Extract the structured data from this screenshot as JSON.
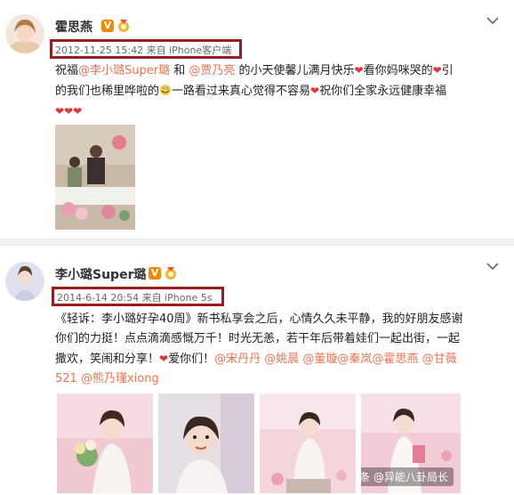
{
  "post1": {
    "username": "霍思燕",
    "timestamp": "2012-11-25 15:42 来自 iPhone客户端",
    "text": {
      "t1": "祝福",
      "m1": "@李小璐Super璐",
      "t2": " 和 ",
      "m2": "@贾乃亮",
      "t3": " 的小天使馨儿满月快乐",
      "t4": "看你妈咪哭的",
      "t5": "引",
      "t6": "的我们也稀里哗啦的",
      "t7": "一路看过来真心觉得不容易",
      "t8": "祝你们全家永远健康幸福",
      "hearts": "❤❤❤"
    }
  },
  "post2": {
    "username": "李小璐Super璐",
    "timestamp": "2014-6-14 20:54 来自 iPhone 5s",
    "text": {
      "l1": "《轻诉：李小璐好孕40周》新书私享会之后，心情久久未平静，我的好朋友感谢",
      "l2": "你们的力挺！点点滴滴感慨万千！时光无恙，若干年后带着娃们一起出街，一起",
      "l3a": "撒欢，笑闹和分享！",
      "l3b": "爱你们！",
      "m1": "@宋丹丹",
      "m2": "@姚晨",
      "m3": "@董璇",
      "m4": "@秦岚",
      "m5": "@霍思燕",
      "m6": "@甘薇",
      "l4a": "521",
      "m7": "@熊乃瑾xiong"
    }
  },
  "badges": {
    "v": "V"
  },
  "watermark": "头条 @异能八卦局长",
  "icons": [
    "chevron-down-icon",
    "verified-badge-icon",
    "medal-icon",
    "heart-icon",
    "emoji-icon"
  ],
  "colors": {
    "highlight": "#9c1b1f",
    "mention": "#eb7350",
    "heart": "#e0353b",
    "verified": "#ee8a00"
  }
}
